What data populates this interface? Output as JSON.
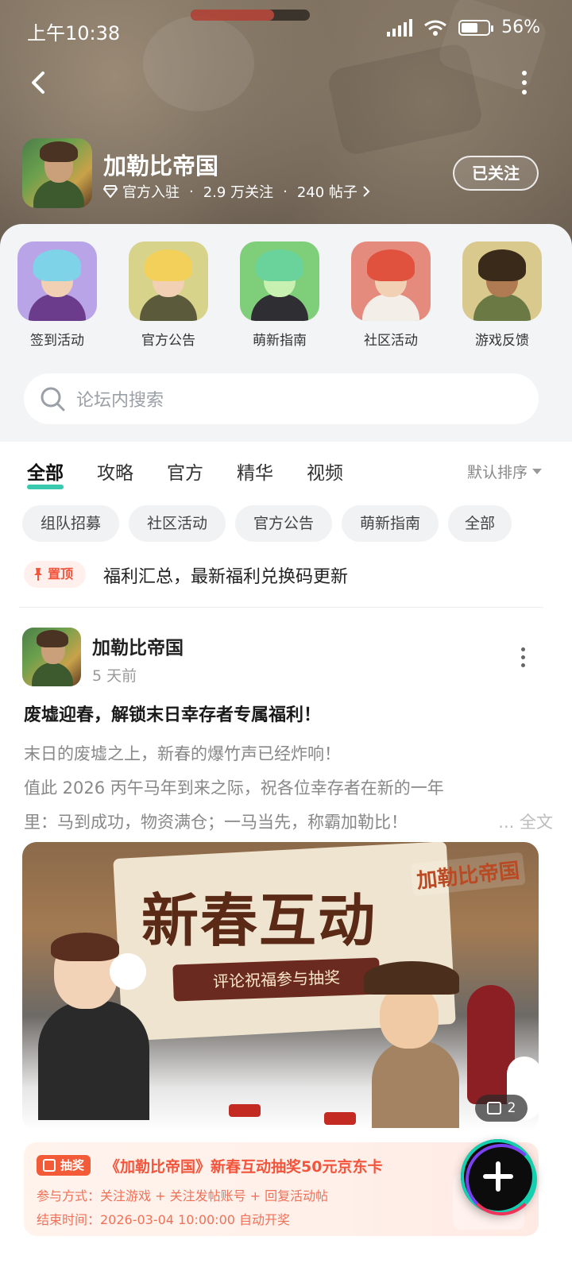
{
  "status_bar": {
    "time": "上午10:38",
    "battery": "56%",
    "battery_level": 0.56
  },
  "header": {
    "game_name": "加勒比帝国",
    "official_label": "官方入驻",
    "followers": "2.9 万关注",
    "posts": "240 帖子",
    "follow_button": "已关注"
  },
  "entries": [
    {
      "label": "签到活动",
      "hair": "#7fd3e8",
      "body": "#6b3b8c"
    },
    {
      "label": "官方公告",
      "hair": "#f2d05a",
      "body": "#5b5a3a"
    },
    {
      "label": "萌新指南",
      "hair": "#6ad29b",
      "body": "#2f2f33"
    },
    {
      "label": "社区活动",
      "hair": "#e0523e",
      "body": "#f3efe8"
    },
    {
      "label": "游戏反馈",
      "hair": "#3a2a1a",
      "body": "#6b7a45"
    }
  ],
  "search": {
    "placeholder": "论坛内搜索"
  },
  "tabs": [
    "全部",
    "攻略",
    "官方",
    "精华",
    "视频"
  ],
  "sort_label": "默认排序",
  "chips": [
    "组队招募",
    "社区活动",
    "官方公告",
    "萌新指南",
    "全部"
  ],
  "pinned": {
    "badge": "置顶",
    "text": "福利汇总，最新福利兑换码更新"
  },
  "post": {
    "author": "加勒比帝国",
    "time": "5 天前",
    "title": "废墟迎春，解锁末日幸存者专属福利！",
    "body_line1": "末日的废墟之上，新春的爆竹声已经炸响！",
    "body_line2": "值此 2026 丙午马年到来之际，祝各位幸存者在新的一年",
    "body_line3": "里：马到成功，物资满仓；一马当先，称霸加勒比！",
    "more": "... 全文",
    "image": {
      "title": "新春互动",
      "subtitle": "评论祝福参与抽奖",
      "logo": "加勒比帝国",
      "count": "2"
    }
  },
  "lottery": {
    "tag": "抽奖",
    "title": "《加勒比帝国》新春互动抽奖50元京东卡",
    "method": "参与方式：关注游戏 + 关注发帖账号 + 回复活动帖",
    "end_time": "结束时间：2026-03-04 10:00:00 自动开奖"
  },
  "colors": {
    "accent": "#22c3a5",
    "pin_red": "#f2553c",
    "lottery_orange": "#f35a37"
  }
}
